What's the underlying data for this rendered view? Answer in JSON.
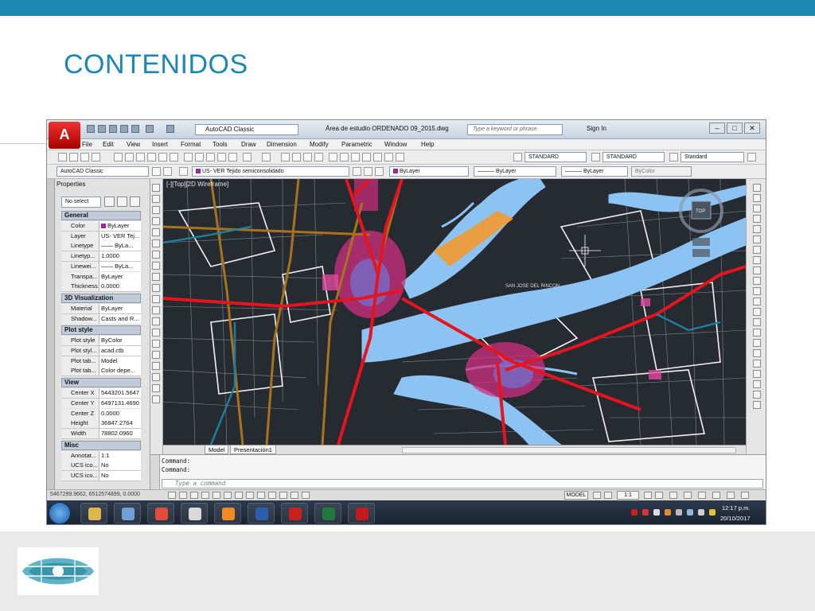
{
  "slide": {
    "title": "CONTENIDOS",
    "accent": "#1a89b4"
  },
  "app": {
    "logo_letter": "A",
    "workspace": "AutoCAD Classic",
    "doc_title": "Área de estudio ORDENADO 09_2015.dwg",
    "search_placeholder": "Type a keyword or phrase",
    "sign_in": "Sign In",
    "window_controls": [
      "–",
      "□",
      "✕"
    ]
  },
  "menu": [
    "File",
    "Edit",
    "View",
    "Insert",
    "Format",
    "Tools",
    "Draw",
    "Dimension",
    "Modify",
    "Parametric",
    "Window",
    "Help"
  ],
  "toolbar1": {
    "text_style": "STANDARD",
    "dim_style": "STANDARD",
    "table_style": "Standard"
  },
  "toolbar2": {
    "workspace": "AutoCAD Classic",
    "layer": "US- VER Tejido semiconsolidado",
    "color": "ByLayer",
    "linetype": "ByLayer",
    "lineweight": "ByLayer",
    "plotstyle": "ByColor"
  },
  "properties": {
    "title": "Properties",
    "selection": "No select",
    "sections": [
      {
        "name": "General",
        "rows": [
          {
            "k": "Color",
            "v": "ByLayer",
            "swatch": true
          },
          {
            "k": "Layer",
            "v": "US- VER Tej..."
          },
          {
            "k": "Linetype",
            "v": "—— ByLa..."
          },
          {
            "k": "Linetyp...",
            "v": "1.0000"
          },
          {
            "k": "Linewei...",
            "v": "—— ByLa..."
          },
          {
            "k": "Transpa...",
            "v": "ByLayer"
          },
          {
            "k": "Thickness",
            "v": "0.0000"
          }
        ]
      },
      {
        "name": "3D Visualization",
        "rows": [
          {
            "k": "Material",
            "v": "ByLayer"
          },
          {
            "k": "Shadow...",
            "v": "Casts and R..."
          }
        ]
      },
      {
        "name": "Plot style",
        "rows": [
          {
            "k": "Plot style",
            "v": "ByColor"
          },
          {
            "k": "Plot styl...",
            "v": "acad.ctb"
          },
          {
            "k": "Plot tab...",
            "v": "Model"
          },
          {
            "k": "Plot tab...",
            "v": "Color depe..."
          }
        ]
      },
      {
        "name": "View",
        "rows": [
          {
            "k": "Center X",
            "v": "5443201.5647"
          },
          {
            "k": "Center Y",
            "v": "6497131.4690"
          },
          {
            "k": "Center Z",
            "v": "0.0000"
          },
          {
            "k": "Height",
            "v": "36847.2764"
          },
          {
            "k": "Width",
            "v": "78802.0960"
          }
        ]
      },
      {
        "name": "Misc",
        "rows": [
          {
            "k": "Annotat...",
            "v": "1:1"
          },
          {
            "k": "UCS ico...",
            "v": "No"
          },
          {
            "k": "UCS ico...",
            "v": "No"
          }
        ]
      }
    ]
  },
  "drawing": {
    "viewport_label": "[-][Top][2D Wireframe]",
    "place_label": "SAN JOSE DEL RINCON",
    "viewcube_label": "TOP",
    "river_color": "#8cc3f2",
    "background": "#262a31"
  },
  "layout_tabs": [
    "Model",
    "Presentación1"
  ],
  "command": {
    "lines": [
      "Command:",
      "Command:"
    ],
    "placeholder": "Type a command"
  },
  "status": {
    "coords": "5467299.9662, 6512574899, 0.0000",
    "model": "MODEL",
    "scale": "1:1"
  },
  "taskbar": {
    "time": "12:17 p.m.",
    "date": "20/10/2017",
    "apps": [
      {
        "name": "explorer",
        "color": "#e0b64a"
      },
      {
        "name": "notepad",
        "color": "#6fa0d6"
      },
      {
        "name": "chrome",
        "color": "#e34b3c"
      },
      {
        "name": "sync",
        "color": "#d9d9d9"
      },
      {
        "name": "firefox",
        "color": "#f28b23"
      },
      {
        "name": "word",
        "color": "#2a5fad"
      },
      {
        "name": "acrobat",
        "color": "#c8201d"
      },
      {
        "name": "excel",
        "color": "#1f7a3c"
      },
      {
        "name": "autocad",
        "color": "#c5191c"
      }
    ]
  }
}
